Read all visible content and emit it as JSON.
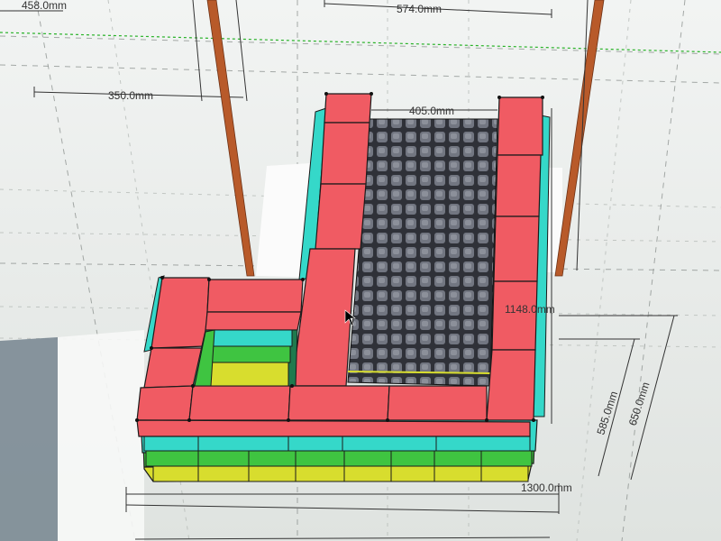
{
  "dimensions": [
    {
      "id": "top_left",
      "text": "458.0mm"
    },
    {
      "id": "top_right",
      "text": "574.0mm"
    },
    {
      "id": "left_mid",
      "text": "350.0mm"
    },
    {
      "id": "grill_width",
      "text": "405.0mm"
    },
    {
      "id": "right_side",
      "text": "1148.0mm"
    },
    {
      "id": "height_inner",
      "text": "585.0mm"
    },
    {
      "id": "height_outer",
      "text": "650.0mm"
    },
    {
      "id": "base_depth",
      "text": "1300.0mm"
    }
  ],
  "colors": {
    "background": "#e9ecea",
    "red_block": "#f05b63",
    "cyan_block": "#35d8c9",
    "green_block": "#3fc441",
    "yellow_block": "#d8dd2e",
    "grate": "#3b3d45",
    "grate_cell": "#6d707a",
    "pole": "#b85a2a",
    "axis_green": "#29b229"
  },
  "icons": {
    "cursor": "mouse-pointer-icon"
  }
}
